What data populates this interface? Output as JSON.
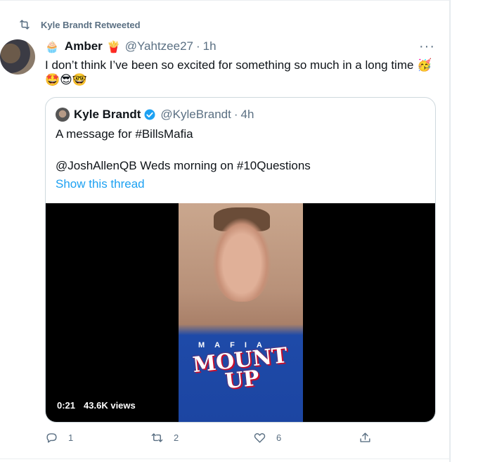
{
  "retweet": {
    "label": "Kyle Brandt Retweeted"
  },
  "tweet": {
    "name": "Amber",
    "name_emoji_before": "🧁",
    "name_emoji_after": "🍟",
    "handle": "@Yahtzee27",
    "separator": "·",
    "time": "1h",
    "more": "···",
    "text": "I don’t think I’ve been so excited for something so much in a long time 🥳",
    "emojis": "🤩😎🤓"
  },
  "quote": {
    "name": "Kyle Brandt",
    "handle": "@KyleBrandt",
    "separator": "·",
    "time": "4h",
    "line1": "A message for #BillsMafia",
    "line2": "@JoshAllenQB Weds morning on #10Questions",
    "thread_link": "Show this thread",
    "video": {
      "duration": "0:21",
      "views": "43.6K views",
      "shirt_top": "MAFIA",
      "shirt_main": "MOUNT UP"
    }
  },
  "actions": {
    "reply_count": "1",
    "retweet_count": "2",
    "like_count": "6"
  },
  "colors": {
    "accent": "#1da1f2",
    "secondary_text": "#5b7083",
    "border": "#cfd9de"
  }
}
